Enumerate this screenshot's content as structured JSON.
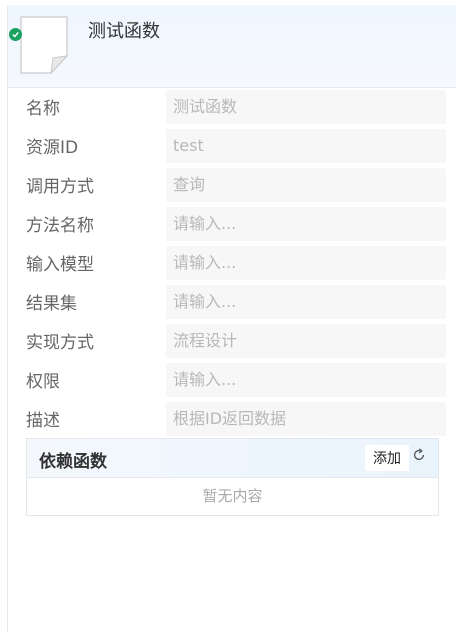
{
  "header": {
    "title": "测试函数",
    "doc_icon": "document-icon",
    "status_icon": "check-circle-icon",
    "status_color": "#1aa260"
  },
  "form": {
    "fields": [
      {
        "label": "名称",
        "value": "测试函数"
      },
      {
        "label": "资源ID",
        "value": "test"
      },
      {
        "label": "调用方式",
        "value": "查询"
      },
      {
        "label": "方法名称",
        "value": "请输入..."
      },
      {
        "label": "输入模型",
        "value": "请输入..."
      },
      {
        "label": "结果集",
        "value": "请输入..."
      },
      {
        "label": "实现方式",
        "value": "流程设计"
      },
      {
        "label": "权限",
        "value": "请输入..."
      },
      {
        "label": "描述",
        "value": "根据ID返回数据"
      }
    ]
  },
  "dependencies": {
    "title": "依赖函数",
    "add_label": "添加",
    "refresh_icon": "refresh-icon",
    "empty_text": "暂无内容"
  }
}
